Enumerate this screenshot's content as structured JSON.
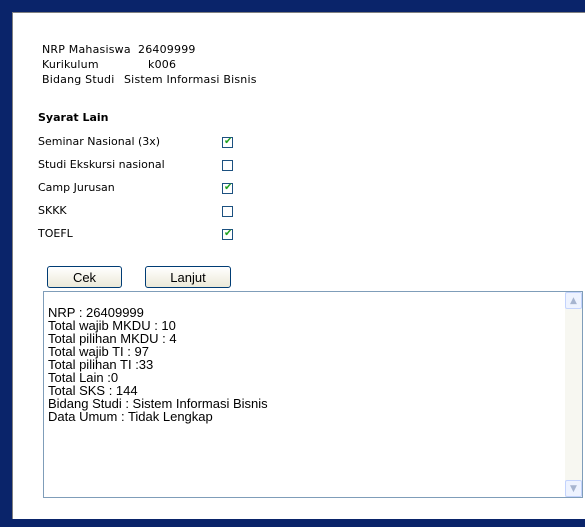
{
  "info": {
    "nrp_label": "NRP Mahasiswa",
    "nrp_value": "26409999",
    "kurikulum_label": "Kurikulum",
    "kurikulum_value": "k006",
    "bidang_label": "Bidang Studi",
    "bidang_value": "Sistem Informasi Bisnis"
  },
  "syarat": {
    "title": "Syarat Lain",
    "items": [
      {
        "label": "Seminar Nasional (3x)",
        "checked": true
      },
      {
        "label": "Studi Ekskursi nasional",
        "checked": false
      },
      {
        "label": "Camp Jurusan",
        "checked": true
      },
      {
        "label": "SKKK",
        "checked": false
      },
      {
        "label": "TOEFL",
        "checked": true
      }
    ]
  },
  "buttons": {
    "cek": "Cek",
    "lanjut": "Lanjut"
  },
  "output": {
    "lines": [
      "NRP : 26409999",
      "Total wajib MKDU : 10",
      "Total pilihan MKDU : 4",
      "Total wajib TI : 97",
      "Total pilihan TI :33",
      "Total Lain :0",
      "Total SKS : 144",
      "Bidang Studi : Sistem Informasi Bisnis",
      "Data Umum : Tidak Lengkap"
    ]
  },
  "icons": {
    "checkmark": "check-icon",
    "scroll_up": "arrow-up-icon",
    "scroll_down": "arrow-down-icon"
  }
}
